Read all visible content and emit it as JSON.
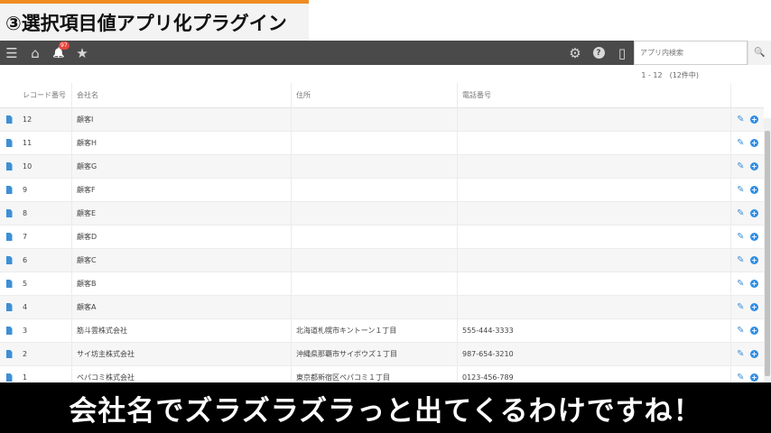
{
  "banner": {
    "title": "③選択項目値アプリ化プラグイン"
  },
  "toolbar": {
    "menu_icon": "☰",
    "home_icon": "⌂",
    "bell_icon": "🔔",
    "notification_count": "97",
    "star_icon": "★",
    "gear_icon": "⚙",
    "help_icon": "?",
    "mobile_icon": "▯",
    "search_placeholder": "アプリ内検索",
    "search_icon": "🔍"
  },
  "pager": {
    "range": "1 - 12　(12件中)"
  },
  "table": {
    "columns": {
      "record_no": "レコード番号",
      "company": "会社名",
      "address": "住所",
      "phone": "電話番号"
    },
    "rows": [
      {
        "record_no": "12",
        "company": "顧客I",
        "address": "",
        "phone": ""
      },
      {
        "record_no": "11",
        "company": "顧客H",
        "address": "",
        "phone": ""
      },
      {
        "record_no": "10",
        "company": "顧客G",
        "address": "",
        "phone": ""
      },
      {
        "record_no": "9",
        "company": "顧客F",
        "address": "",
        "phone": ""
      },
      {
        "record_no": "8",
        "company": "顧客E",
        "address": "",
        "phone": ""
      },
      {
        "record_no": "7",
        "company": "顧客D",
        "address": "",
        "phone": ""
      },
      {
        "record_no": "6",
        "company": "顧客C",
        "address": "",
        "phone": ""
      },
      {
        "record_no": "5",
        "company": "顧客B",
        "address": "",
        "phone": ""
      },
      {
        "record_no": "4",
        "company": "顧客A",
        "address": "",
        "phone": ""
      },
      {
        "record_no": "3",
        "company": "筋斗雲株式会社",
        "address": "北海道札幌市キントーン１丁目",
        "phone": "555-444-3333"
      },
      {
        "record_no": "2",
        "company": "サイ坊主株式会社",
        "address": "沖縄県那覇市サイボウズ１丁目",
        "phone": "987-654-3210"
      },
      {
        "record_no": "1",
        "company": "ペパコミ株式会社",
        "address": "東京都新宿区ペパコミ１丁目",
        "phone": "0123-456-789"
      }
    ]
  },
  "subtitle": {
    "text": "会社名でズラズラズラっと出てくるわけですね！"
  }
}
